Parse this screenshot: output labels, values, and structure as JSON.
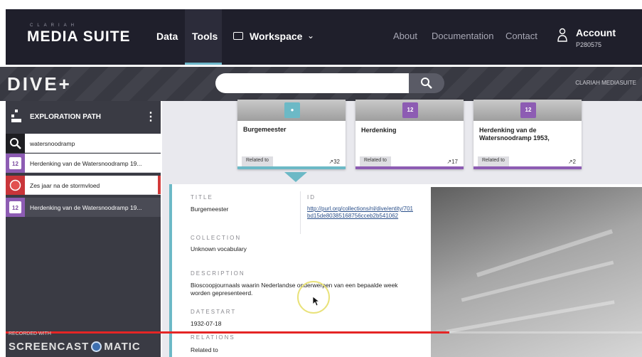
{
  "header": {
    "logo_small": "CLARIAH",
    "logo_big": "MEDIA SUITE",
    "nav": {
      "data": "Data",
      "tools": "Tools",
      "workspace": "Workspace",
      "about": "About",
      "documentation": "Documentation",
      "contact": "Contact"
    },
    "account": {
      "label": "Account",
      "id": "P280575"
    }
  },
  "dive": {
    "logo": "DIVE+",
    "search_placeholder": "",
    "right_label": "CLARIAH MEDIASUITE"
  },
  "sidebar": {
    "title": "EXPLORATION PATH",
    "items": [
      {
        "label": "watersnoodramp",
        "icon": "search-icon"
      },
      {
        "label": "Herdenking van de Watersnoodramp 19...",
        "icon": "calendar-icon",
        "icon_text": "12"
      },
      {
        "label": "Zes jaar na de stormvloed",
        "icon": "event-icon"
      },
      {
        "label": "Herdenking van de Watersnoodramp 19...",
        "icon": "calendar-icon",
        "icon_text": "12"
      }
    ]
  },
  "cards": [
    {
      "title": "Burgemeester",
      "related": "Related to",
      "count": "32",
      "accent": "#6cb9c6"
    },
    {
      "title": "Herdenking",
      "related": "Related to",
      "count": "17",
      "accent": "#8d5cb3",
      "badge": "12"
    },
    {
      "title": "Herdenking van de Watersnoodramp 1953,",
      "related": "Related to",
      "count": "2",
      "accent": "#8d5cb3",
      "badge": "12"
    }
  ],
  "detail": {
    "title_label": "TITLE",
    "title_value": "Burgemeester",
    "id_label": "ID",
    "id_value": "http://purl.org/collections/nl/dive/entity/701bd15de80385168756cceb2b541062",
    "collection_label": "COLLECTION",
    "collection_value": "Unknown vocabulary",
    "description_label": "DESCRIPTION",
    "description_value": "Bioscoopjournaals waarin Nederlandse onderwerpen van een bepaalde week worden gepresenteerd.",
    "datestart_label": "DATESTART",
    "datestart_value": "1932-07-18",
    "relations_label": "RELATIONS",
    "relations_value": "Related to"
  },
  "recording": {
    "small": "RECORDED WITH",
    "big_left": "SCREENCAST",
    "big_right": "MATIC",
    "progress": 0.697
  },
  "colors": {
    "accent_teal": "#6cb9c6",
    "accent_purple": "#8d5cb3",
    "accent_red": "#c9353a",
    "header_bg": "#1f1f2b"
  }
}
